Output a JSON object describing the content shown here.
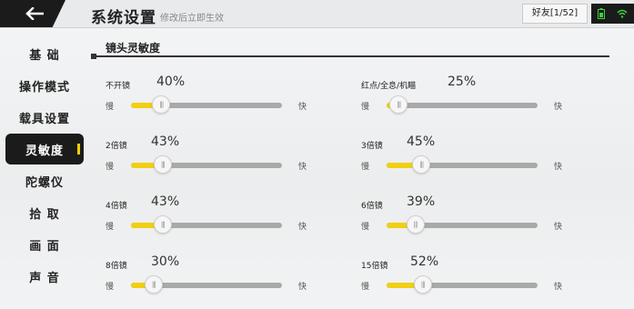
{
  "header": {
    "title": "系统设置",
    "subtitle": "修改后立即生效",
    "friends": "好友[1/52]"
  },
  "sidebar": {
    "items": [
      {
        "label": "基 础",
        "active": false
      },
      {
        "label": "操作模式",
        "active": false
      },
      {
        "label": "载具设置",
        "active": false
      },
      {
        "label": "灵敏度",
        "active": true
      },
      {
        "label": "陀螺仪",
        "active": false
      },
      {
        "label": "拾 取",
        "active": false
      },
      {
        "label": "画 面",
        "active": false
      },
      {
        "label": "声 音",
        "active": false
      }
    ]
  },
  "section": {
    "title": "镜头灵敏度"
  },
  "slider_labels": {
    "slow": "慢",
    "fast": "快"
  },
  "settings": [
    {
      "name": "不开镜",
      "value": "40%",
      "fill": 0.2
    },
    {
      "name": "红点/全息/机瞄",
      "value": "25%",
      "fill": 0.08
    },
    {
      "name": "2倍镜",
      "value": "43%",
      "fill": 0.21
    },
    {
      "name": "3倍镜",
      "value": "45%",
      "fill": 0.23
    },
    {
      "name": "4倍镜",
      "value": "43%",
      "fill": 0.21
    },
    {
      "name": "6倍镜",
      "value": "39%",
      "fill": 0.19
    },
    {
      "name": "8倍镜",
      "value": "30%",
      "fill": 0.15
    },
    {
      "name": "15倍镜",
      "value": "52%",
      "fill": 0.24
    }
  ],
  "colors": {
    "accent": "#f1cf14",
    "dark": "#1b1b1b",
    "signal": "#3ad13a"
  }
}
